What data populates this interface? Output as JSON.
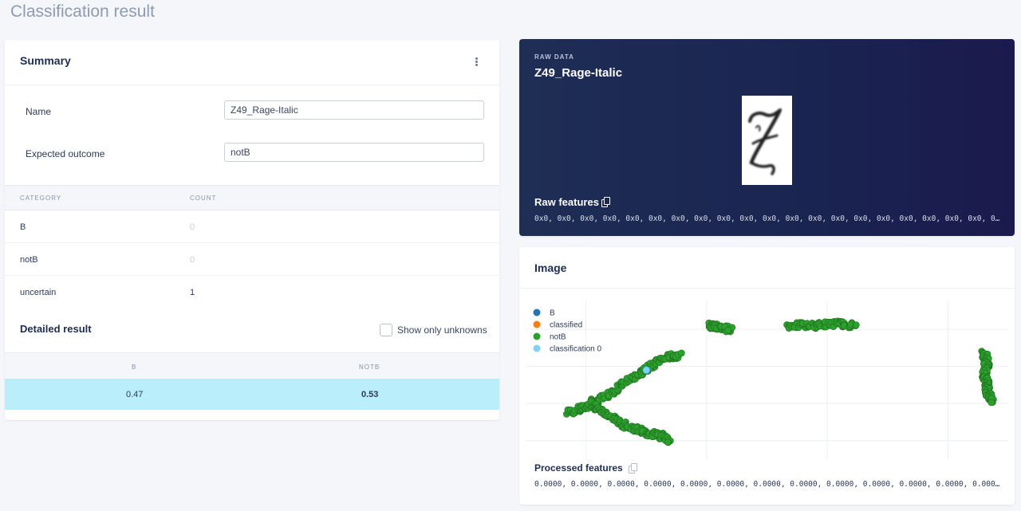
{
  "page": {
    "title": "Classification result"
  },
  "summary": {
    "title": "Summary",
    "name_label": "Name",
    "name_value": "Z49_Rage-Italic",
    "expected_label": "Expected outcome",
    "expected_value": "notB",
    "table_headers": [
      "CATEGORY",
      "COUNT"
    ],
    "rows": [
      {
        "category": "B",
        "count": "0"
      },
      {
        "category": "notB",
        "count": "0"
      },
      {
        "category": "uncertain",
        "count": "1"
      }
    ]
  },
  "detailed": {
    "title": "Detailed result",
    "show_unknowns_label": "Show only unknowns",
    "show_unknowns_checked": false,
    "headers": [
      "B",
      "NOTB"
    ],
    "values": [
      "0.47",
      "0.53"
    ]
  },
  "raw": {
    "kicker": "RAW DATA",
    "title": "Z49_Rage-Italic",
    "features_title": "Raw features",
    "features_values": "0x0, 0x0, 0x0, 0x0, 0x0, 0x0, 0x0, 0x0, 0x0, 0x0, 0x0, 0x0, 0x0, 0x0, 0x0, 0x0, 0x0, 0x0, 0x0, 0x0, 0x0,…"
  },
  "image_panel": {
    "title": "Image",
    "processed_title": "Processed features",
    "processed_values": "0.0000, 0.0000, 0.0000, 0.0000, 0.0000, 0.0000, 0.0000, 0.0000, 0.0000, 0.0000, 0.0000, 0.0000, 0.0000, …",
    "legend": [
      {
        "label": "B",
        "color": "#1f77b4"
      },
      {
        "label": "classified",
        "color": "#ff7f0e"
      },
      {
        "label": "notB",
        "color": "#2ca02c"
      },
      {
        "label": "classification 0",
        "color": "#7fd3f7"
      }
    ]
  },
  "chart_data": {
    "type": "scatter",
    "title": "",
    "xlabel": "",
    "ylabel": "",
    "grid": true,
    "legend_placement": "top-left",
    "series": [
      {
        "name": "B",
        "points": []
      },
      {
        "name": "classified",
        "points": []
      },
      {
        "name": "notB",
        "segments": [
          [
            [
              -8.6,
              1.5
            ],
            [
              -8.0,
              1.8
            ],
            [
              -7.4,
              2.3
            ],
            [
              -6.8,
              3.0
            ],
            [
              -6.2,
              3.6
            ],
            [
              -5.8,
              4.1
            ],
            [
              -5.3,
              4.5
            ],
            [
              -4.9,
              4.6
            ]
          ],
          [
            [
              -7.9,
              2.1
            ],
            [
              -7.5,
              1.6
            ],
            [
              -7.0,
              1.1
            ],
            [
              -6.5,
              0.7
            ],
            [
              -6.0,
              0.4
            ],
            [
              -5.6,
              0.3
            ],
            [
              -5.2,
              0.0
            ]
          ],
          [
            [
              -3.9,
              6.2
            ],
            [
              -3.6,
              6.1
            ],
            [
              -3.2,
              6.0
            ]
          ],
          [
            [
              -1.3,
              6.2
            ],
            [
              -0.5,
              6.2
            ],
            [
              0.3,
              6.3
            ],
            [
              0.9,
              6.2
            ]
          ],
          [
            [
              5.2,
              4.7
            ],
            [
              5.3,
              4.2
            ],
            [
              5.2,
              3.6
            ],
            [
              5.3,
              3.1
            ],
            [
              5.3,
              2.6
            ],
            [
              5.5,
              2.1
            ]
          ]
        ]
      },
      {
        "name": "classification 0",
        "points": [
          [
            -6.0,
            3.8
          ]
        ]
      }
    ]
  }
}
